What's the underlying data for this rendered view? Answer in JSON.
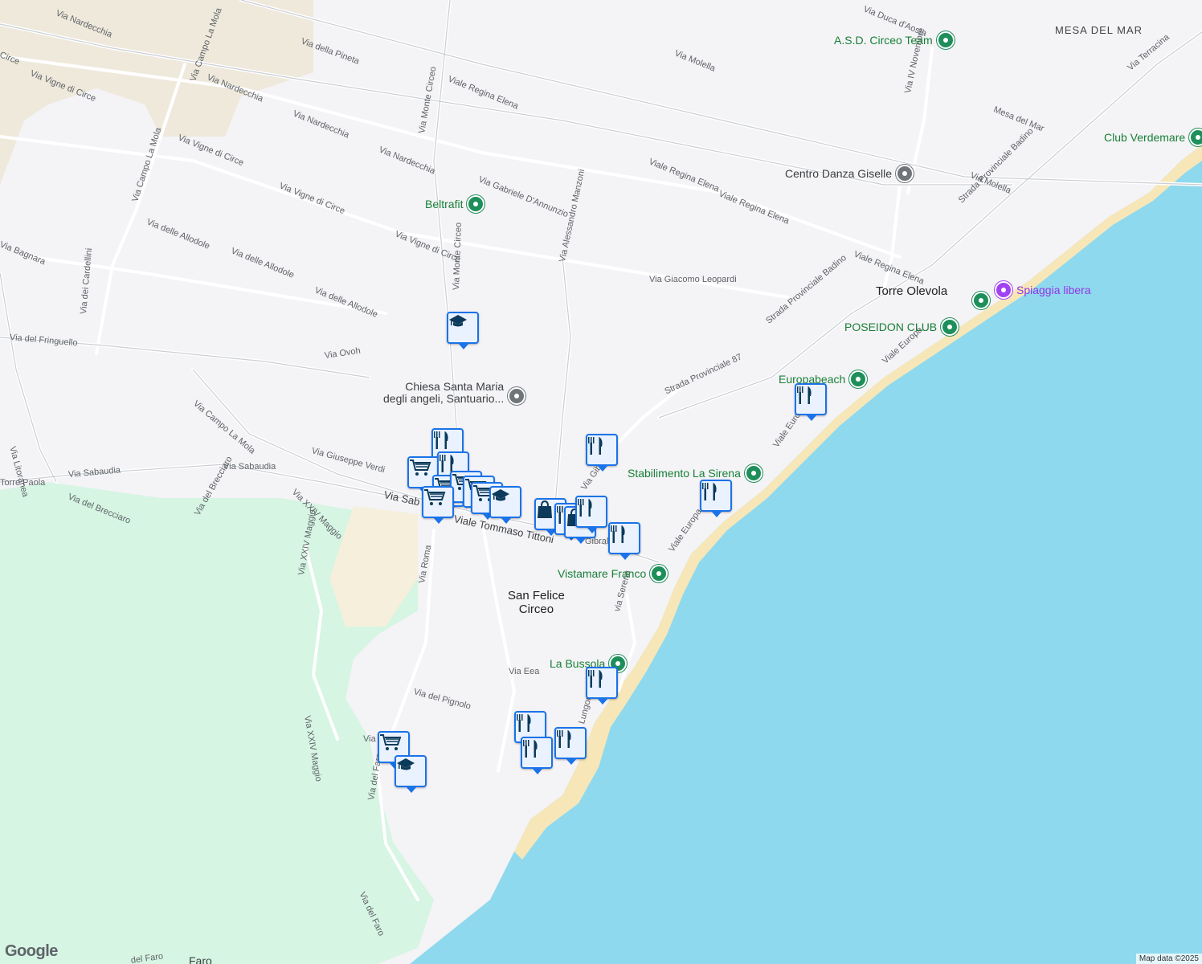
{
  "map": {
    "attribution": "Map data ©2025",
    "logo": "Google",
    "colors": {
      "land": "#f4f3f6",
      "water": "#8fd9ee",
      "park": "#d6f5e3",
      "sand": "#f5e9c8",
      "road": "#ffffff",
      "poi_green": "#1e8e5a"
    }
  },
  "places": {
    "san_felice": "San Felice\nCirceo",
    "torre_olevola": "Torre Olevola",
    "mesa_del_mar": "MESA DEL MAR"
  },
  "streets": {
    "s01": "Via Nardecchia",
    "s02": "Via della Pineta",
    "s03": "Via Campo La Mola",
    "s04": "Via Nardecchia",
    "s05": "Via Nardecchia",
    "s06": "Via Nardecchia",
    "s07": "Via Vigne di Circe",
    "s08": "Via Vigne di Circe",
    "s09": "Via Vigne di Circe",
    "s10": "Via Vigne di Circe",
    "s11": "Via Campo La Mola",
    "s12": "Via delle Allodole",
    "s13": "Via delle Allodole",
    "s14": "Via delle Allodole",
    "s15": "Via Monte Circeo",
    "s16": "Viale Regina Elena",
    "s17": "Via Gabriele D'Annunzio",
    "s18": "Via Alessandro Manzoni",
    "s19": "Viale Regina Elena",
    "s20": "Viale Regina Elena",
    "s21": "Via Giacomo Leopardi",
    "s22": "Via Molella",
    "s23": "Via Duca d'Aosta",
    "s24": "Via IV Novembre",
    "s25": "Mesa del Mar",
    "s26": "Via Molella",
    "s27": "Viale Regina Elena",
    "s28": "Via Terracina",
    "s29": "Strada Provinciale Badino",
    "s30": "Strada Provinciale Badino",
    "s31": "Strada Provinciale 87",
    "s32": "Viale Europa",
    "s33": "Viale Europa",
    "s34": "Viale Europa",
    "s35": "Via del Fringuello",
    "s36": "Via dei Cardellini",
    "s37": "Via Bagnara",
    "s38": "Via Ovoh",
    "s39": "Via Campo La Mola",
    "s40": "Via Giuseppe Verdi",
    "s41": "Via Sabaudia",
    "s42": "Via Sabaudia",
    "s43": "Via Litoranea",
    "s44": "Torre Paola",
    "s45": "Via del Brecciaro",
    "s46": "Via del Brecciaro",
    "s47": "Via XXIV Maggio",
    "s48": "Viale Tommaso Tittoni",
    "s49": "Via Roma",
    "s50": "Via XXIV Maggio",
    "s51": "Via XXIV Maggio",
    "s52": "via Serena",
    "s53": "Via Eea",
    "s54": "Via del Pignolo",
    "s55": "Via del Faro",
    "s56": "Via del Faro",
    "s57": "Lungomare C",
    "s58": "Via Monte Circeo",
    "s59": "Gibral",
    "s60": "Circe",
    "s61": "Via",
    "s62": "del Faro",
    "s63": "Faro",
    "s64": "Via Gibral",
    "s65": "Via Gibraltina",
    "s66": "Via Sab"
  },
  "pois": {
    "p01": "A.S.D. Circeo Team",
    "p02": "Club Verdemare",
    "p03": "Centro Danza Giselle",
    "p04": "Beltrafit",
    "p05": "Spiaggia libera",
    "p06": "POSEIDON CLUB",
    "p07": "Europabeach",
    "p08": "Chiesa Santa Maria\ndegli angeli, Santuario...",
    "p09": "Stabilimento La Sirena",
    "p10": "Vistamare Franco",
    "p11": "La Bussola"
  },
  "markers": {
    "m01": "graduation-cap-icon",
    "m02": "restaurant-icon",
    "m03": "shopping-cart-icon",
    "m04": "shopping-bag-icon"
  }
}
